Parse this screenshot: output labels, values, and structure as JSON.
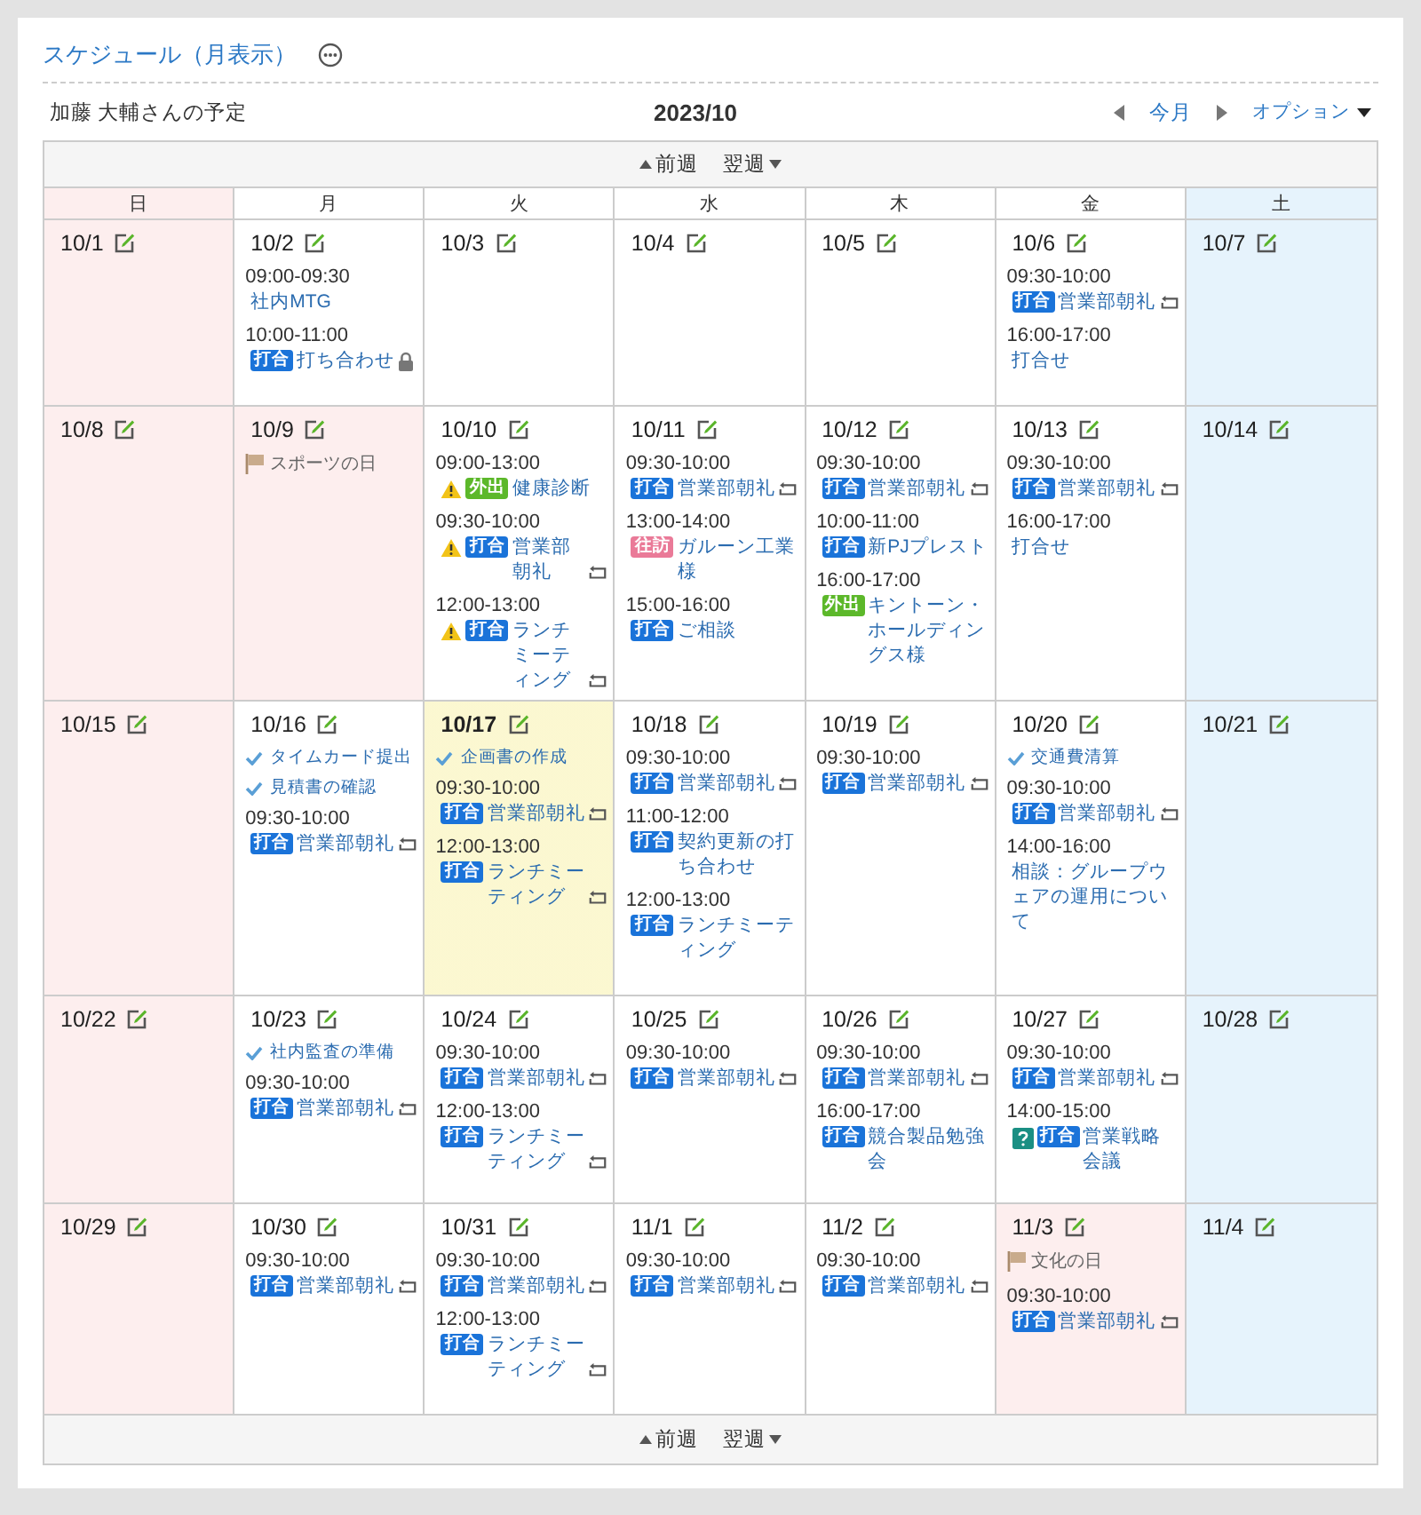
{
  "header": {
    "title": "スケジュール（月表示）",
    "owner": "加藤 大輔さんの予定",
    "month": "2023/10",
    "today_link": "今月",
    "options": "オプション"
  },
  "nav_top": {
    "prev": "前週",
    "next": "翌週"
  },
  "weekdays": [
    {
      "label": "日",
      "kind": "sun"
    },
    {
      "label": "月",
      "kind": "weekday"
    },
    {
      "label": "火",
      "kind": "weekday"
    },
    {
      "label": "水",
      "kind": "weekday"
    },
    {
      "label": "木",
      "kind": "weekday"
    },
    {
      "label": "金",
      "kind": "weekday"
    },
    {
      "label": "土",
      "kind": "sat"
    }
  ],
  "weeks": [
    [
      {
        "date": "10/1",
        "kind": "sun",
        "today": false
      },
      {
        "date": "10/2",
        "kind": "weekday",
        "today": false,
        "items": [
          {
            "kind": "event",
            "time": "09:00-09:30",
            "title": "社内MTG",
            "warning": false,
            "unconfirmed": false,
            "repeat": false,
            "private": false
          },
          {
            "kind": "event",
            "time": "10:00-11:00",
            "tag": {
              "label": "打合",
              "color": "#1a73d9"
            },
            "title": "打ち合わせ",
            "warning": false,
            "unconfirmed": false,
            "repeat": false,
            "private": true
          }
        ]
      },
      {
        "date": "10/3",
        "kind": "weekday",
        "today": false
      },
      {
        "date": "10/4",
        "kind": "weekday",
        "today": false
      },
      {
        "date": "10/5",
        "kind": "weekday",
        "today": false
      },
      {
        "date": "10/6",
        "kind": "weekday",
        "today": false,
        "items": [
          {
            "kind": "event",
            "time": "09:30-10:00",
            "tag": {
              "label": "打合",
              "color": "#1a73d9"
            },
            "title": "営業部朝礼",
            "warning": false,
            "unconfirmed": false,
            "repeat": true,
            "private": false
          },
          {
            "kind": "event",
            "time": "16:00-17:00",
            "title": "打合せ",
            "warning": false,
            "unconfirmed": false,
            "repeat": false,
            "private": false
          }
        ]
      },
      {
        "date": "10/7",
        "kind": "sat",
        "today": false
      }
    ],
    [
      {
        "date": "10/8",
        "kind": "sun",
        "today": false
      },
      {
        "date": "10/9",
        "kind": "holiday",
        "today": false,
        "holiday": "スポーツの日"
      },
      {
        "date": "10/10",
        "kind": "weekday",
        "today": false,
        "items": [
          {
            "kind": "event",
            "time": "09:00-13:00",
            "tag": {
              "label": "外出",
              "color": "#5cb82a"
            },
            "title": "健康診断",
            "warning": true,
            "unconfirmed": false,
            "repeat": false,
            "private": false
          },
          {
            "kind": "event",
            "time": "09:30-10:00",
            "tag": {
              "label": "打合",
              "color": "#1a73d9"
            },
            "title": "営業部朝礼",
            "warning": true,
            "unconfirmed": false,
            "repeat": true,
            "private": false
          },
          {
            "kind": "event",
            "time": "12:00-13:00",
            "tag": {
              "label": "打合",
              "color": "#1a73d9"
            },
            "title": "ランチミーティング",
            "warning": true,
            "unconfirmed": false,
            "repeat": true,
            "private": false
          }
        ]
      },
      {
        "date": "10/11",
        "kind": "weekday",
        "today": false,
        "items": [
          {
            "kind": "event",
            "time": "09:30-10:00",
            "tag": {
              "label": "打合",
              "color": "#1a73d9"
            },
            "title": "営業部朝礼",
            "warning": false,
            "unconfirmed": false,
            "repeat": true,
            "private": false
          },
          {
            "kind": "event",
            "time": "13:00-14:00",
            "tag": {
              "label": "往訪",
              "color": "#ea7a98"
            },
            "title": "ガルーン工業様",
            "warning": false,
            "unconfirmed": false,
            "repeat": false,
            "private": false
          },
          {
            "kind": "event",
            "time": "15:00-16:00",
            "tag": {
              "label": "打合",
              "color": "#1a73d9"
            },
            "title": "ご相談",
            "warning": false,
            "unconfirmed": false,
            "repeat": false,
            "private": false
          }
        ]
      },
      {
        "date": "10/12",
        "kind": "weekday",
        "today": false,
        "items": [
          {
            "kind": "event",
            "time": "09:30-10:00",
            "tag": {
              "label": "打合",
              "color": "#1a73d9"
            },
            "title": "営業部朝礼",
            "warning": false,
            "unconfirmed": false,
            "repeat": true,
            "private": false
          },
          {
            "kind": "event",
            "time": "10:00-11:00",
            "tag": {
              "label": "打合",
              "color": "#1a73d9"
            },
            "title": "新PJプレスト",
            "warning": false,
            "unconfirmed": false,
            "repeat": false,
            "private": false
          },
          {
            "kind": "event",
            "time": "16:00-17:00",
            "tag": {
              "label": "外出",
              "color": "#5cb82a"
            },
            "title": "キントーン・ホールディングス様",
            "warning": false,
            "unconfirmed": false,
            "repeat": false,
            "private": false
          }
        ]
      },
      {
        "date": "10/13",
        "kind": "weekday",
        "today": false,
        "items": [
          {
            "kind": "event",
            "time": "09:30-10:00",
            "tag": {
              "label": "打合",
              "color": "#1a73d9"
            },
            "title": "営業部朝礼",
            "warning": false,
            "unconfirmed": false,
            "repeat": true,
            "private": false
          },
          {
            "kind": "event",
            "time": "16:00-17:00",
            "title": "打合せ",
            "warning": false,
            "unconfirmed": false,
            "repeat": false,
            "private": false
          }
        ]
      },
      {
        "date": "10/14",
        "kind": "sat",
        "today": false
      }
    ],
    [
      {
        "date": "10/15",
        "kind": "sun",
        "today": false
      },
      {
        "date": "10/16",
        "kind": "weekday",
        "today": false,
        "items": [
          {
            "kind": "todo",
            "text": "タイムカード提出"
          },
          {
            "kind": "todo",
            "text": "見積書の確認"
          },
          {
            "kind": "event",
            "time": "09:30-10:00",
            "tag": {
              "label": "打合",
              "color": "#1a73d9"
            },
            "title": "営業部朝礼",
            "warning": false,
            "unconfirmed": false,
            "repeat": true,
            "private": false
          }
        ]
      },
      {
        "date": "10/17",
        "kind": "weekday",
        "today": true,
        "items": [
          {
            "kind": "todo",
            "text": "企画書の作成"
          },
          {
            "kind": "event",
            "time": "09:30-10:00",
            "tag": {
              "label": "打合",
              "color": "#1a73d9"
            },
            "title": "営業部朝礼",
            "warning": false,
            "unconfirmed": false,
            "repeat": true,
            "private": false
          },
          {
            "kind": "event",
            "time": "12:00-13:00",
            "tag": {
              "label": "打合",
              "color": "#1a73d9"
            },
            "title": "ランチミーティング",
            "warning": false,
            "unconfirmed": false,
            "repeat": true,
            "private": false
          }
        ]
      },
      {
        "date": "10/18",
        "kind": "weekday",
        "today": false,
        "items": [
          {
            "kind": "event",
            "time": "09:30-10:00",
            "tag": {
              "label": "打合",
              "color": "#1a73d9"
            },
            "title": "営業部朝礼",
            "warning": false,
            "unconfirmed": false,
            "repeat": true,
            "private": false
          },
          {
            "kind": "event",
            "time": "11:00-12:00",
            "tag": {
              "label": "打合",
              "color": "#1a73d9"
            },
            "title": "契約更新の打ち合わせ",
            "warning": false,
            "unconfirmed": false,
            "repeat": false,
            "private": false
          },
          {
            "kind": "event",
            "time": "12:00-13:00",
            "tag": {
              "label": "打合",
              "color": "#1a73d9"
            },
            "title": "ランチミーティング",
            "warning": false,
            "unconfirmed": false,
            "repeat": false,
            "private": false
          }
        ]
      },
      {
        "date": "10/19",
        "kind": "weekday",
        "today": false,
        "items": [
          {
            "kind": "event",
            "time": "09:30-10:00",
            "tag": {
              "label": "打合",
              "color": "#1a73d9"
            },
            "title": "営業部朝礼",
            "warning": false,
            "unconfirmed": false,
            "repeat": true,
            "private": false
          }
        ]
      },
      {
        "date": "10/20",
        "kind": "weekday",
        "today": false,
        "items": [
          {
            "kind": "todo",
            "text": "交通費清算"
          },
          {
            "kind": "event",
            "time": "09:30-10:00",
            "tag": {
              "label": "打合",
              "color": "#1a73d9"
            },
            "title": "営業部朝礼",
            "warning": false,
            "unconfirmed": false,
            "repeat": true,
            "private": false
          },
          {
            "kind": "event",
            "time": "14:00-16:00",
            "title": "相談：グループウェアの運用について",
            "warning": false,
            "unconfirmed": false,
            "repeat": false,
            "private": false
          }
        ]
      },
      {
        "date": "10/21",
        "kind": "sat",
        "today": false
      }
    ],
    [
      {
        "date": "10/22",
        "kind": "sun",
        "today": false
      },
      {
        "date": "10/23",
        "kind": "weekday",
        "today": false,
        "items": [
          {
            "kind": "todo",
            "text": "社内監査の準備"
          },
          {
            "kind": "event",
            "time": "09:30-10:00",
            "tag": {
              "label": "打合",
              "color": "#1a73d9"
            },
            "title": "営業部朝礼",
            "warning": false,
            "unconfirmed": false,
            "repeat": true,
            "private": false
          }
        ]
      },
      {
        "date": "10/24",
        "kind": "weekday",
        "today": false,
        "items": [
          {
            "kind": "event",
            "time": "09:30-10:00",
            "tag": {
              "label": "打合",
              "color": "#1a73d9"
            },
            "title": "営業部朝礼",
            "warning": false,
            "unconfirmed": false,
            "repeat": true,
            "private": false
          },
          {
            "kind": "event",
            "time": "12:00-13:00",
            "tag": {
              "label": "打合",
              "color": "#1a73d9"
            },
            "title": "ランチミーティング",
            "warning": false,
            "unconfirmed": false,
            "repeat": true,
            "private": false
          }
        ]
      },
      {
        "date": "10/25",
        "kind": "weekday",
        "today": false,
        "items": [
          {
            "kind": "event",
            "time": "09:30-10:00",
            "tag": {
              "label": "打合",
              "color": "#1a73d9"
            },
            "title": "営業部朝礼",
            "warning": false,
            "unconfirmed": false,
            "repeat": true,
            "private": false
          }
        ]
      },
      {
        "date": "10/26",
        "kind": "weekday",
        "today": false,
        "items": [
          {
            "kind": "event",
            "time": "09:30-10:00",
            "tag": {
              "label": "打合",
              "color": "#1a73d9"
            },
            "title": "営業部朝礼",
            "warning": false,
            "unconfirmed": false,
            "repeat": true,
            "private": false
          },
          {
            "kind": "event",
            "time": "16:00-17:00",
            "tag": {
              "label": "打合",
              "color": "#1a73d9"
            },
            "title": "競合製品勉強会",
            "warning": false,
            "unconfirmed": false,
            "repeat": false,
            "private": false
          }
        ]
      },
      {
        "date": "10/27",
        "kind": "weekday",
        "today": false,
        "items": [
          {
            "kind": "event",
            "time": "09:30-10:00",
            "tag": {
              "label": "打合",
              "color": "#1a73d9"
            },
            "title": "営業部朝礼",
            "warning": false,
            "unconfirmed": false,
            "repeat": true,
            "private": false
          },
          {
            "kind": "event",
            "time": "14:00-15:00",
            "tag": {
              "label": "打合",
              "color": "#1a73d9"
            },
            "title": "営業戦略会議",
            "warning": false,
            "unconfirmed": true,
            "repeat": false,
            "private": false
          }
        ]
      },
      {
        "date": "10/28",
        "kind": "sat",
        "today": false
      }
    ],
    [
      {
        "date": "10/29",
        "kind": "sun",
        "today": false
      },
      {
        "date": "10/30",
        "kind": "weekday",
        "today": false,
        "items": [
          {
            "kind": "event",
            "time": "09:30-10:00",
            "tag": {
              "label": "打合",
              "color": "#1a73d9"
            },
            "title": "営業部朝礼",
            "warning": false,
            "unconfirmed": false,
            "repeat": true,
            "private": false
          }
        ]
      },
      {
        "date": "10/31",
        "kind": "weekday",
        "today": false,
        "items": [
          {
            "kind": "event",
            "time": "09:30-10:00",
            "tag": {
              "label": "打合",
              "color": "#1a73d9"
            },
            "title": "営業部朝礼",
            "warning": false,
            "unconfirmed": false,
            "repeat": true,
            "private": false
          },
          {
            "kind": "event",
            "time": "12:00-13:00",
            "tag": {
              "label": "打合",
              "color": "#1a73d9"
            },
            "title": "ランチミーティング",
            "warning": false,
            "unconfirmed": false,
            "repeat": true,
            "private": false
          }
        ]
      },
      {
        "date": "11/1",
        "kind": "weekday",
        "today": false,
        "items": [
          {
            "kind": "event",
            "time": "09:30-10:00",
            "tag": {
              "label": "打合",
              "color": "#1a73d9"
            },
            "title": "営業部朝礼",
            "warning": false,
            "unconfirmed": false,
            "repeat": true,
            "private": false
          }
        ]
      },
      {
        "date": "11/2",
        "kind": "weekday",
        "today": false,
        "items": [
          {
            "kind": "event",
            "time": "09:30-10:00",
            "tag": {
              "label": "打合",
              "color": "#1a73d9"
            },
            "title": "営業部朝礼",
            "warning": false,
            "unconfirmed": false,
            "repeat": true,
            "private": false
          }
        ]
      },
      {
        "date": "11/3",
        "kind": "holiday",
        "today": false,
        "holiday": "文化の日",
        "items": [
          {
            "kind": "event",
            "time": "09:30-10:00",
            "tag": {
              "label": "打合",
              "color": "#1a73d9"
            },
            "title": "営業部朝礼",
            "warning": false,
            "unconfirmed": false,
            "repeat": true,
            "private": false
          }
        ]
      },
      {
        "date": "11/4",
        "kind": "sat",
        "today": false
      }
    ]
  ],
  "nav_bottom": {
    "prev": "前週",
    "next": "翌週"
  }
}
